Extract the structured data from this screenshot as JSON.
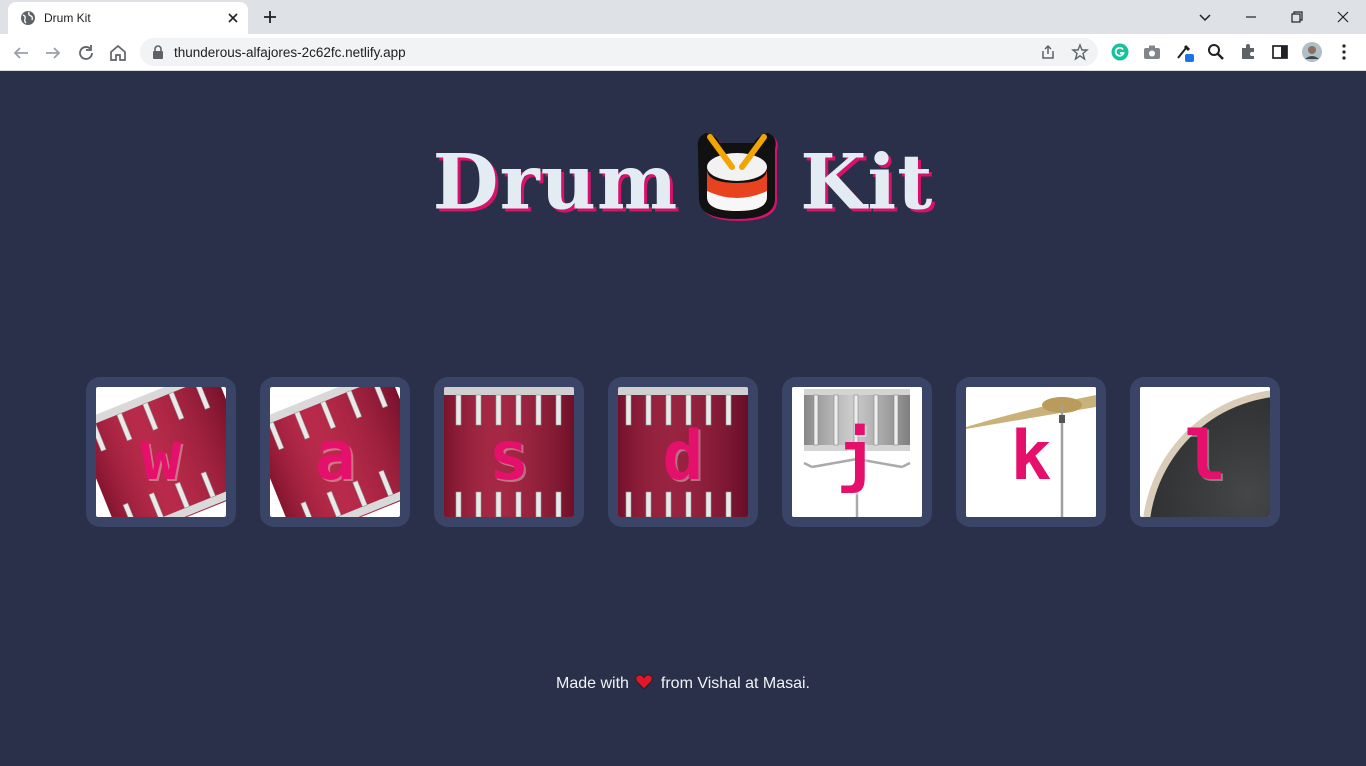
{
  "browser": {
    "tab_title": "Drum Kit",
    "url": "thunderous-alfajores-2c62fc.netlify.app"
  },
  "page": {
    "title_left": "Drum",
    "title_right": "Kit",
    "keys": [
      {
        "letter": "w"
      },
      {
        "letter": "a"
      },
      {
        "letter": "s"
      },
      {
        "letter": "d"
      },
      {
        "letter": "j"
      },
      {
        "letter": "k"
      },
      {
        "letter": "l"
      }
    ],
    "footer": {
      "prefix": "Made with",
      "suffix": "from Vishal at Masai."
    }
  },
  "colors": {
    "background": "#2a3049",
    "key_frame": "#3a4466",
    "letter": "#e4106c",
    "title": "#e3ecf3"
  }
}
